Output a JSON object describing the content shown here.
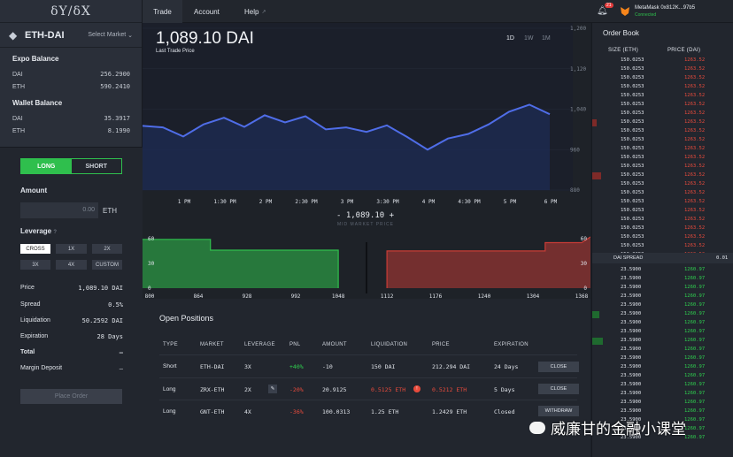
{
  "brand": "δY/δX",
  "pair": {
    "name": "ETH-DAI",
    "select_label": "Select Market"
  },
  "expo_balance": {
    "title": "Expo Balance",
    "rows": [
      {
        "k": "DAI",
        "v": "256.2900"
      },
      {
        "k": "ETH",
        "v": "590.2410"
      }
    ]
  },
  "wallet_balance": {
    "title": "Wallet Balance",
    "rows": [
      {
        "k": "DAI",
        "v": "35.3917"
      },
      {
        "k": "ETH",
        "v": "8.1990"
      }
    ]
  },
  "trade_form": {
    "long_label": "LONG",
    "short_label": "SHORT",
    "amount_label": "Amount",
    "amount_placeholder": "0.00",
    "amount_unit": "ETH",
    "leverage_label": "Leverage",
    "leverage_options": [
      "CROSS",
      "1X",
      "2X",
      "3X",
      "4X",
      "CUSTOM"
    ],
    "leverage_selected": "CROSS",
    "summary": [
      {
        "k": "Price",
        "v": "1,089.10 DAI"
      },
      {
        "k": "Spread",
        "v": "0.5%"
      },
      {
        "k": "Liquidation",
        "v": "50.2592 DAI"
      },
      {
        "k": "Expiration",
        "v": "28 Days"
      },
      {
        "k": "Total",
        "v": "–"
      },
      {
        "k": "Margin Deposit",
        "v": "–"
      }
    ],
    "place_order_label": "Place Order"
  },
  "nav": {
    "tabs": [
      "Trade",
      "Account",
      "Help"
    ],
    "active": "Trade",
    "notification_count": "21"
  },
  "wallet": {
    "name": "MetaMask 0x812K...97b5",
    "status": "Connected",
    "colors": {
      "fox": "#f6851b",
      "connected": "#2fbf4d"
    }
  },
  "chart": {
    "last_price": "1,089.10 DAI",
    "last_price_label": "Last Trade Price",
    "timeframes": [
      "1D",
      "1W",
      "1M"
    ],
    "active_timeframe": "1D",
    "mid_price": "- 1,089.10 +",
    "mid_label": "MID MARKET PRICE"
  },
  "chart_data": [
    {
      "type": "area",
      "x": [
        "12:40 PM",
        "1 PM",
        "1:15 PM",
        "1:30 PM",
        "1:45 PM",
        "1:55 PM",
        "2 PM",
        "2:15 PM",
        "2:30 PM",
        "2:45 PM",
        "3 PM",
        "3:15 PM",
        "3:30 PM",
        "3:45 PM",
        "4 PM",
        "4:15 PM",
        "4:30 PM",
        "4:45 PM",
        "5 PM",
        "5:30 PM",
        "5:50 PM"
      ],
      "series": [
        {
          "values": [
            1007,
            1004,
            986,
            1010,
            1023,
            1005,
            1028,
            1014,
            1026,
            1000,
            1004,
            995,
            1008,
            985,
            960,
            982,
            991,
            1010,
            1035,
            1049,
            1030
          ]
        }
      ],
      "x_ticks": [
        "1 PM",
        "1:30 PM",
        "2 PM",
        "2:30 PM",
        "3 PM",
        "3:30 PM",
        "4 PM",
        "4:30 PM",
        "5 PM",
        "6 PM"
      ],
      "y_ticks": [
        "1,200",
        "1,120",
        "1,040",
        "960",
        "880"
      ],
      "ylim": [
        880,
        1200
      ],
      "colors": {
        "line": "#4f6de8",
        "fill": "#1e2f63"
      }
    },
    {
      "type": "area",
      "title": "",
      "x_ticks": [
        "800",
        "864",
        "928",
        "992",
        "1048",
        "1112",
        "1176",
        "1240",
        "1304",
        "1368"
      ],
      "y_ticks": [
        "60",
        "30",
        "0"
      ],
      "series": [
        {
          "name": "bids",
          "points": [
            [
              800,
              59
            ],
            [
              880,
              59
            ],
            [
              880,
              46
            ],
            [
              1048,
              46
            ],
            [
              1048,
              0
            ]
          ]
        },
        {
          "name": "asks",
          "points": [
            [
              1112,
              0
            ],
            [
              1112,
              45
            ],
            [
              1320,
              45
            ],
            [
              1320,
              55
            ],
            [
              1368,
              55
            ],
            [
              1368,
              62
            ]
          ]
        }
      ],
      "colors": {
        "bids": "#2fbf4d",
        "asks": "#c93c36"
      }
    }
  ],
  "positions": {
    "title": "Open Positions",
    "columns": [
      "TYPE",
      "MARKET",
      "LEVERAGE",
      "PNL",
      "AMOUNT",
      "LIQUIDATION",
      "PRICE",
      "EXPIRATION"
    ],
    "rows": [
      {
        "type": "Short",
        "market": "ETH-DAI",
        "leverage": "3X",
        "pnl": "+40%",
        "amount": "-10",
        "liquidation": "150 DAI",
        "price": "212.294 DAI",
        "expiration": "24 Days",
        "action": "CLOSE"
      },
      {
        "type": "Long",
        "market": "ZRX-ETH",
        "leverage": "2X",
        "pnl": "-20%",
        "amount": "20.9125",
        "liquidation": "0.5125 ETH",
        "price": "0.5212 ETH",
        "expiration": "5 Days",
        "action": "CLOSE"
      },
      {
        "type": "Long",
        "market": "GNT-ETH",
        "leverage": "4X",
        "pnl": "-36%",
        "amount": "100.0313",
        "liquidation": "1.25 ETH",
        "price": "1.2429 ETH",
        "expiration": "Closed",
        "action": "WITHDRAW"
      }
    ]
  },
  "order_book": {
    "title": "Order Book",
    "col_size": "SIZE (ETH)",
    "col_price": "PRICE (DAI)",
    "ask_size": "150.0253",
    "ask_price": "1263.52",
    "ask_count": 23,
    "spread_label": "DAI SPREAD",
    "spread_value": "0.01",
    "bid_size": "23.5900",
    "bid_price": "1260.97",
    "bid_count": 20,
    "colors": {
      "ask": "#e94b3c",
      "bid": "#2fd14f"
    }
  },
  "watermark": "威廉甘的金融小课堂"
}
